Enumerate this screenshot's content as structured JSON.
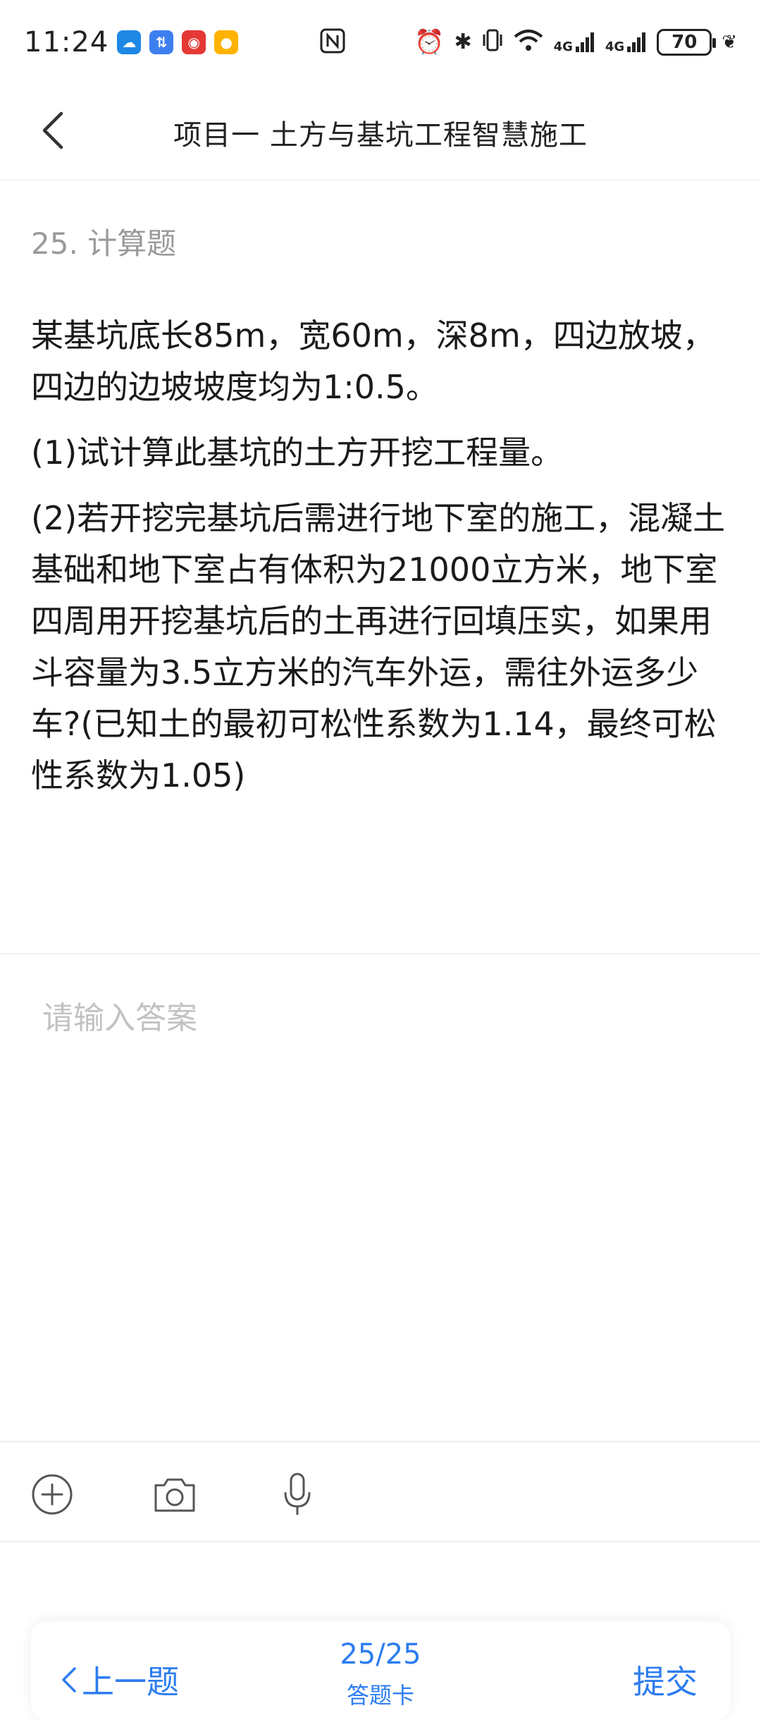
{
  "status_bar": {
    "time": "11:24",
    "battery": "70",
    "network_1": "4G",
    "network_2": "4G",
    "icons": [
      "weather-app-icon",
      "app-icon",
      "chat-app-icon",
      "game-app-icon",
      "nfc-icon",
      "alarm-icon",
      "bluetooth-icon",
      "vibrate-icon",
      "wifi-icon",
      "signal-icon",
      "signal-icon",
      "battery-icon",
      "leaf-icon"
    ]
  },
  "header": {
    "title": "项目一 土方与基坑工程智慧施工",
    "back_icon": "chevron-left-icon"
  },
  "question": {
    "meta": "25. 计算题",
    "paragraphs": [
      "某基坑底长85m，宽60m，深8m，四边放坡，四边的边坡坡度均为1:0.5。",
      "(1)试计算此基坑的土方开挖工程量。",
      "(2)若开挖完基坑后需进行地下室的施工，混凝土基础和地下室占有体积为21000立方米，地下室四周用开挖基坑后的土再进行回填压实，如果用斗容量为3.5立方米的汽车外运，需往外运多少车?(已知土的最初可松性系数为1.14，最终可松性系数为1.05)"
    ]
  },
  "answer": {
    "placeholder": "请输入答案",
    "value": ""
  },
  "tools": {
    "add_icon": "plus-circle-icon",
    "camera_icon": "camera-icon",
    "mic_icon": "microphone-icon"
  },
  "bottom_nav": {
    "prev_label": "上一题",
    "progress": "25/25",
    "card_label": "答题卡",
    "submit_label": "提交"
  },
  "colors": {
    "accent": "#2d7df0",
    "muted": "#9a9a9a",
    "placeholder": "#c2c2c2"
  }
}
